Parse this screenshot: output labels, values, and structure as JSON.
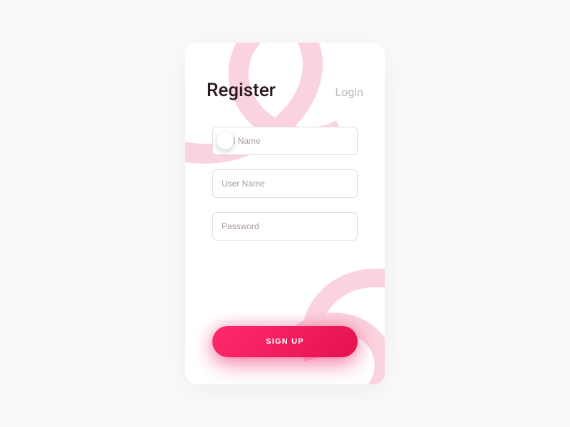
{
  "tabs": {
    "register": "Register",
    "login": "Login"
  },
  "form": {
    "fullname_placeholder": "Full Name",
    "username_placeholder": "User Name",
    "password_placeholder": "Password"
  },
  "cta": {
    "signup_label": "SIGN UP"
  },
  "colors": {
    "accent": "#ed1159",
    "swirl": "#fad3de",
    "heading": "#2a1a1e",
    "inactive": "#b8b8b8"
  }
}
